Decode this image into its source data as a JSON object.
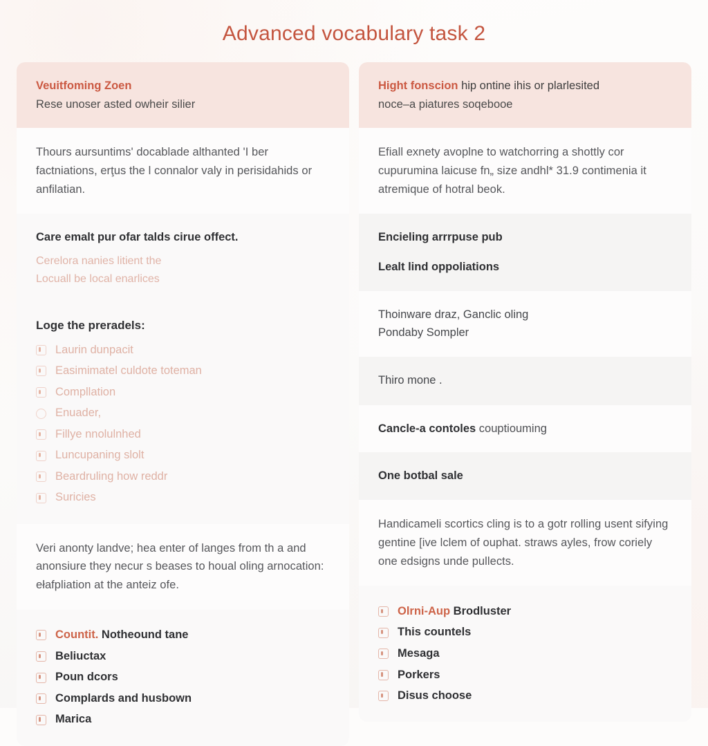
{
  "page": {
    "title": "Advanced vocabulary task 2",
    "accent_color": "#c4553f",
    "header_card_bg": "#f7e4df",
    "background": "#fdfcfb"
  },
  "left_column": {
    "header_card": {
      "accent_text": "Veuitfoming Zoen",
      "sub_text": "Rese unoser asted owheir silier"
    },
    "intro_paragraph": "Thours aursuntims' docablade althanted 'I ber factniations, erţus the l connalor valy in perisidahids or anfilatian.",
    "effect_block": {
      "heading": "Care emalt pur ofar talds cirue offect.",
      "soft_line_1": "Cerelora nanies litient the",
      "soft_line_2": "Locuall be local enarlices"
    },
    "list_block": {
      "title": "Loge the preradels:",
      "items": [
        {
          "label": "Laurin dunpacit",
          "icon": "square-dot-icon"
        },
        {
          "label": "Easimimatel culdote toteman",
          "icon": "square-dot-icon"
        },
        {
          "label": "Compllation",
          "icon": "square-dot-icon"
        },
        {
          "label": "Enuader,",
          "icon": "ring-icon"
        },
        {
          "label": "Fillye nnolulnhed",
          "icon": "square-dot-icon"
        },
        {
          "label": "Luncupaning slolt",
          "icon": "square-dot-icon"
        },
        {
          "label": "Beardruling how reddr",
          "icon": "square-dot-icon"
        },
        {
          "label": "Suricies",
          "icon": "square-dot-icon"
        }
      ]
    },
    "closing_paragraph": "Veri anonty landve; hea enter of langes from th a and anonsiure they necur s beases to houal oling arnocation: ełafpliation at the anteiz ofe.",
    "summary_list": {
      "items": [
        {
          "accent": "Countit.",
          "label": "Notheound tane",
          "icon": "square-dot-icon"
        },
        {
          "accent": "",
          "label": "Beliuctax",
          "icon": "square-dot-icon"
        },
        {
          "accent": "",
          "label": "Poun dcors",
          "icon": "square-dot-icon"
        },
        {
          "accent": "",
          "label": "Complards and husbown",
          "icon": "square-dot-icon"
        },
        {
          "accent": "",
          "label": "Marica",
          "icon": "square-dot-icon"
        }
      ]
    }
  },
  "right_column": {
    "header_card": {
      "accent_text": "Hight fonscion",
      "inline_rest": " hip ontine ihis or plarlesited",
      "sub_text": "noce–a piatures soqebooe"
    },
    "intro_paragraph": "Efiall exnety avoplne to watchorring a shottly cor cupurumina laicuse fn„ size andhl* 31.9 contimenia it atremique of hotral beok.",
    "pair_block": {
      "line_1": "Encieling arrrpuse pub",
      "line_2": "Lealt lind oppoliations"
    },
    "note_block": {
      "line_1": "Thoinware draz, Ganclic oling",
      "line_2": "Pondaby Sompler"
    },
    "single_row": "Thiro mone .",
    "mixed_row": {
      "strong": "Cancle-a contoles",
      "tail": " couptiouming"
    },
    "plain_row": "One botbal sale",
    "closing_paragraph": "Handicameli scortics cling is to a gotr rolling usent sifying gentine [ive lclem of ouphat. straws ayles, frow coriely one edsigns unde pullects.",
    "summary_list": {
      "items": [
        {
          "accent": "Olrni-Aup",
          "label": "Brodluster",
          "icon": "square-dot-icon"
        },
        {
          "accent": "",
          "label": "This countels",
          "icon": "square-dot-icon"
        },
        {
          "accent": "",
          "label": "Mesaga",
          "icon": "square-dot-icon"
        },
        {
          "accent": "",
          "label": "Porkers",
          "icon": "square-dot-icon"
        },
        {
          "accent": "",
          "label": "Disus choose",
          "icon": "square-dot-icon"
        }
      ]
    }
  }
}
